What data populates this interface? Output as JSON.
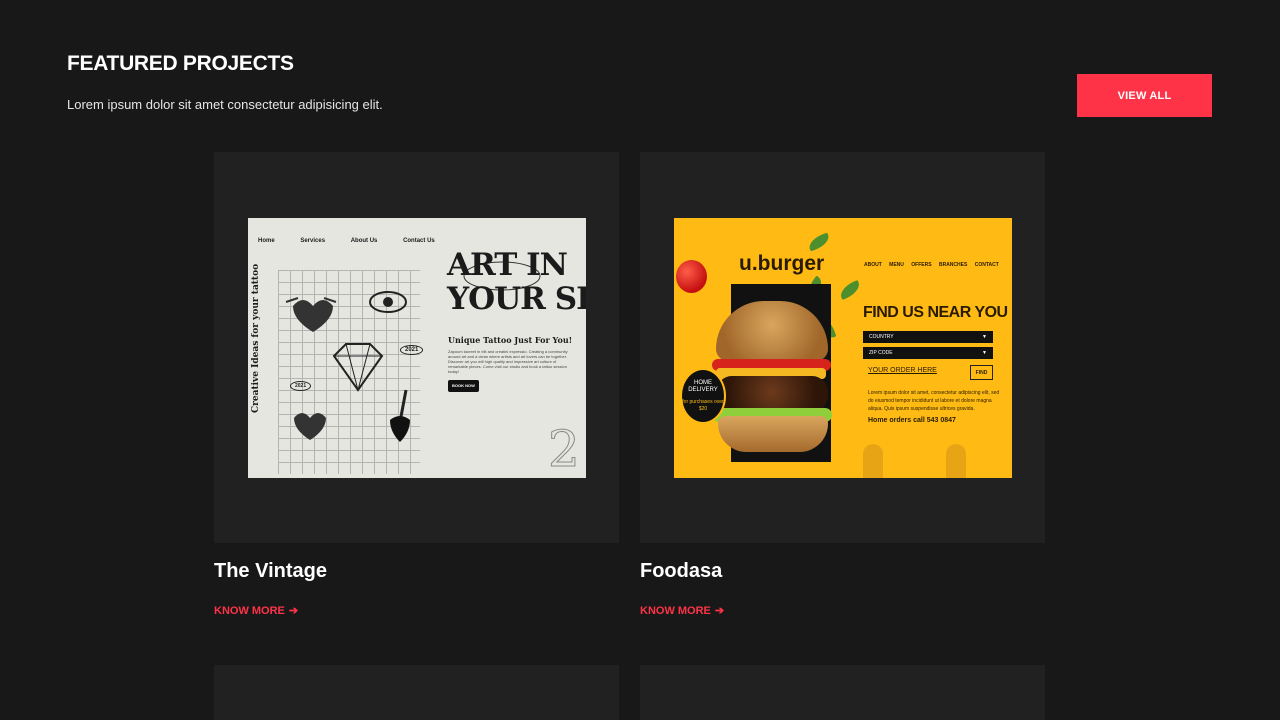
{
  "header": {
    "title": "FEATURED PROJECTS",
    "subtitle": "Lorem ipsum dolor sit amet consectetur adipisicing elit.",
    "view_all_label": "VIEW ALL"
  },
  "colors": {
    "accent": "#ff3347",
    "background": "#181818",
    "card": "#212121"
  },
  "projects": [
    {
      "name": "The Vintage",
      "link_label": "KNOW MORE",
      "preview": {
        "nav": [
          "Home",
          "Services",
          "About Us",
          "Contact Us"
        ],
        "side_text": "Creative Ideas for your tattoo",
        "headline_1": "ART IN",
        "headline_2": "YOUR SKIN",
        "subheading": "Unique Tattoo Just For You!",
        "body": "Zapoum laoreet in elit and creatini expressio. Creating a community around art and a clean where artists and art lovers can be together. Discover art you will high quality and impressive art culture of remarkable pieces. Come visit our studio and book a tattoo session today!",
        "button": "BOOK NOW",
        "year": "2021",
        "year_small": "2021"
      }
    },
    {
      "name": "Foodasa",
      "link_label": "KNOW MORE",
      "preview": {
        "logo": "u.burger",
        "nav": [
          "ABOUT",
          "MENU",
          "OFFERS",
          "BRANCHES",
          "CONTACT"
        ],
        "headline": "FIND US NEAR YOU",
        "field_1": "COUNTRY",
        "field_2": "ZIP CODE",
        "order_link": "YOUR ORDER HERE",
        "find_button": "FIND",
        "body": "Lorem ipsum dolor sit amet, consectetur adipiscing elit, sed do eiusmod tempor incididunt ut labore et dolore magna aliqua. Quis ipsum suspendisse ultrices gravida.",
        "call": "Home orders call 543 0847",
        "badge_line_1": "HOME",
        "badge_line_2": "DELIVERY",
        "badge_small": "for purchases over $20"
      }
    }
  ]
}
